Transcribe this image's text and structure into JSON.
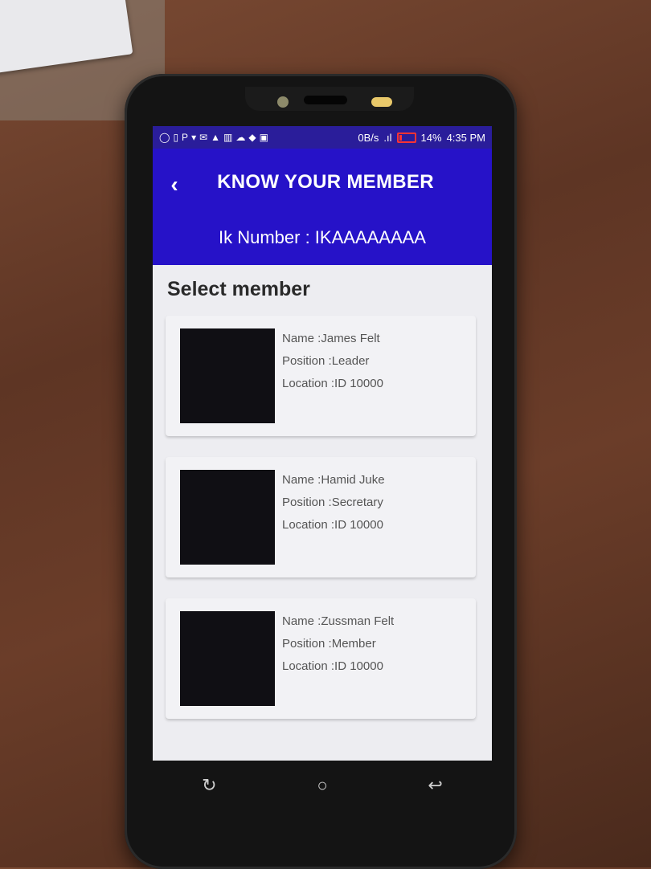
{
  "status_bar": {
    "icons": [
      "chat-icon",
      "sim-icon",
      "p-icon",
      "shirt-icon",
      "mail-icon",
      "warning-icon",
      "sd-icon",
      "cloud-icon",
      "shield-icon",
      "image-icon"
    ],
    "speed": "0B/s",
    "battery": "14%",
    "time": "4:35 PM",
    "color": "#2a1d9a"
  },
  "header": {
    "title": "KNOW YOUR MEMBER",
    "ik_number": "Ik Number : IKAAAAAAAA",
    "color": "#2612c8"
  },
  "section_title": "Select member",
  "members": [
    {
      "name": "Name :James Felt",
      "position": "Position :Leader",
      "location": "Location :ID 10000"
    },
    {
      "name": "Name :Hamid Juke",
      "position": "Position :Secretary",
      "location": "Location :ID 10000"
    },
    {
      "name": "Name :Zussman Felt",
      "position": "Position :Member",
      "location": "Location :ID 10000"
    }
  ],
  "nav_bar": {
    "recents": "recents-icon",
    "home": "home-icon",
    "back": "back-icon"
  }
}
